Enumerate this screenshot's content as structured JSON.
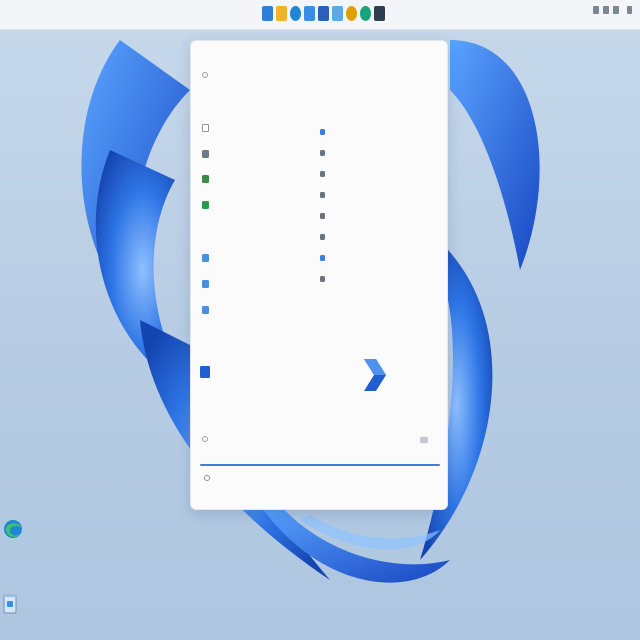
{
  "taskbar": {
    "center_icons": [
      {
        "name": "start-icon",
        "color": "#2f7fd8"
      },
      {
        "name": "file-explorer-icon",
        "color": "#f0b429"
      },
      {
        "name": "edge-icon",
        "color": "#1e88d8"
      },
      {
        "name": "store-icon",
        "color": "#3a8ee6"
      },
      {
        "name": "word-icon",
        "color": "#2b5fb8"
      },
      {
        "name": "notepad-icon",
        "color": "#5aa9e6"
      },
      {
        "name": "chrome-icon",
        "color": "#e0a100"
      },
      {
        "name": "settings-icon",
        "color": "#1aa37a"
      },
      {
        "name": "terminal-icon",
        "color": "#2c3e50"
      }
    ]
  },
  "start_menu": {
    "query_row": "",
    "sections": {
      "best_match_heading": "",
      "documents_heading": "",
      "apps_heading": "",
      "web_heading": ""
    },
    "left_results": [],
    "document_results": [],
    "app_results": [],
    "web_results": [],
    "right_panel": {
      "items": [],
      "featured_app_name": ""
    },
    "search": {
      "placeholder": ""
    }
  },
  "desktop": {
    "icons": [
      {
        "name": "edge-desktop-icon",
        "label": ""
      },
      {
        "name": "recycle-bin-icon",
        "label": ""
      }
    ]
  },
  "colors": {
    "accent": "#3d7fd6",
    "bloom_dark": "#1b4fbf",
    "bloom_light": "#3c8cf0"
  }
}
